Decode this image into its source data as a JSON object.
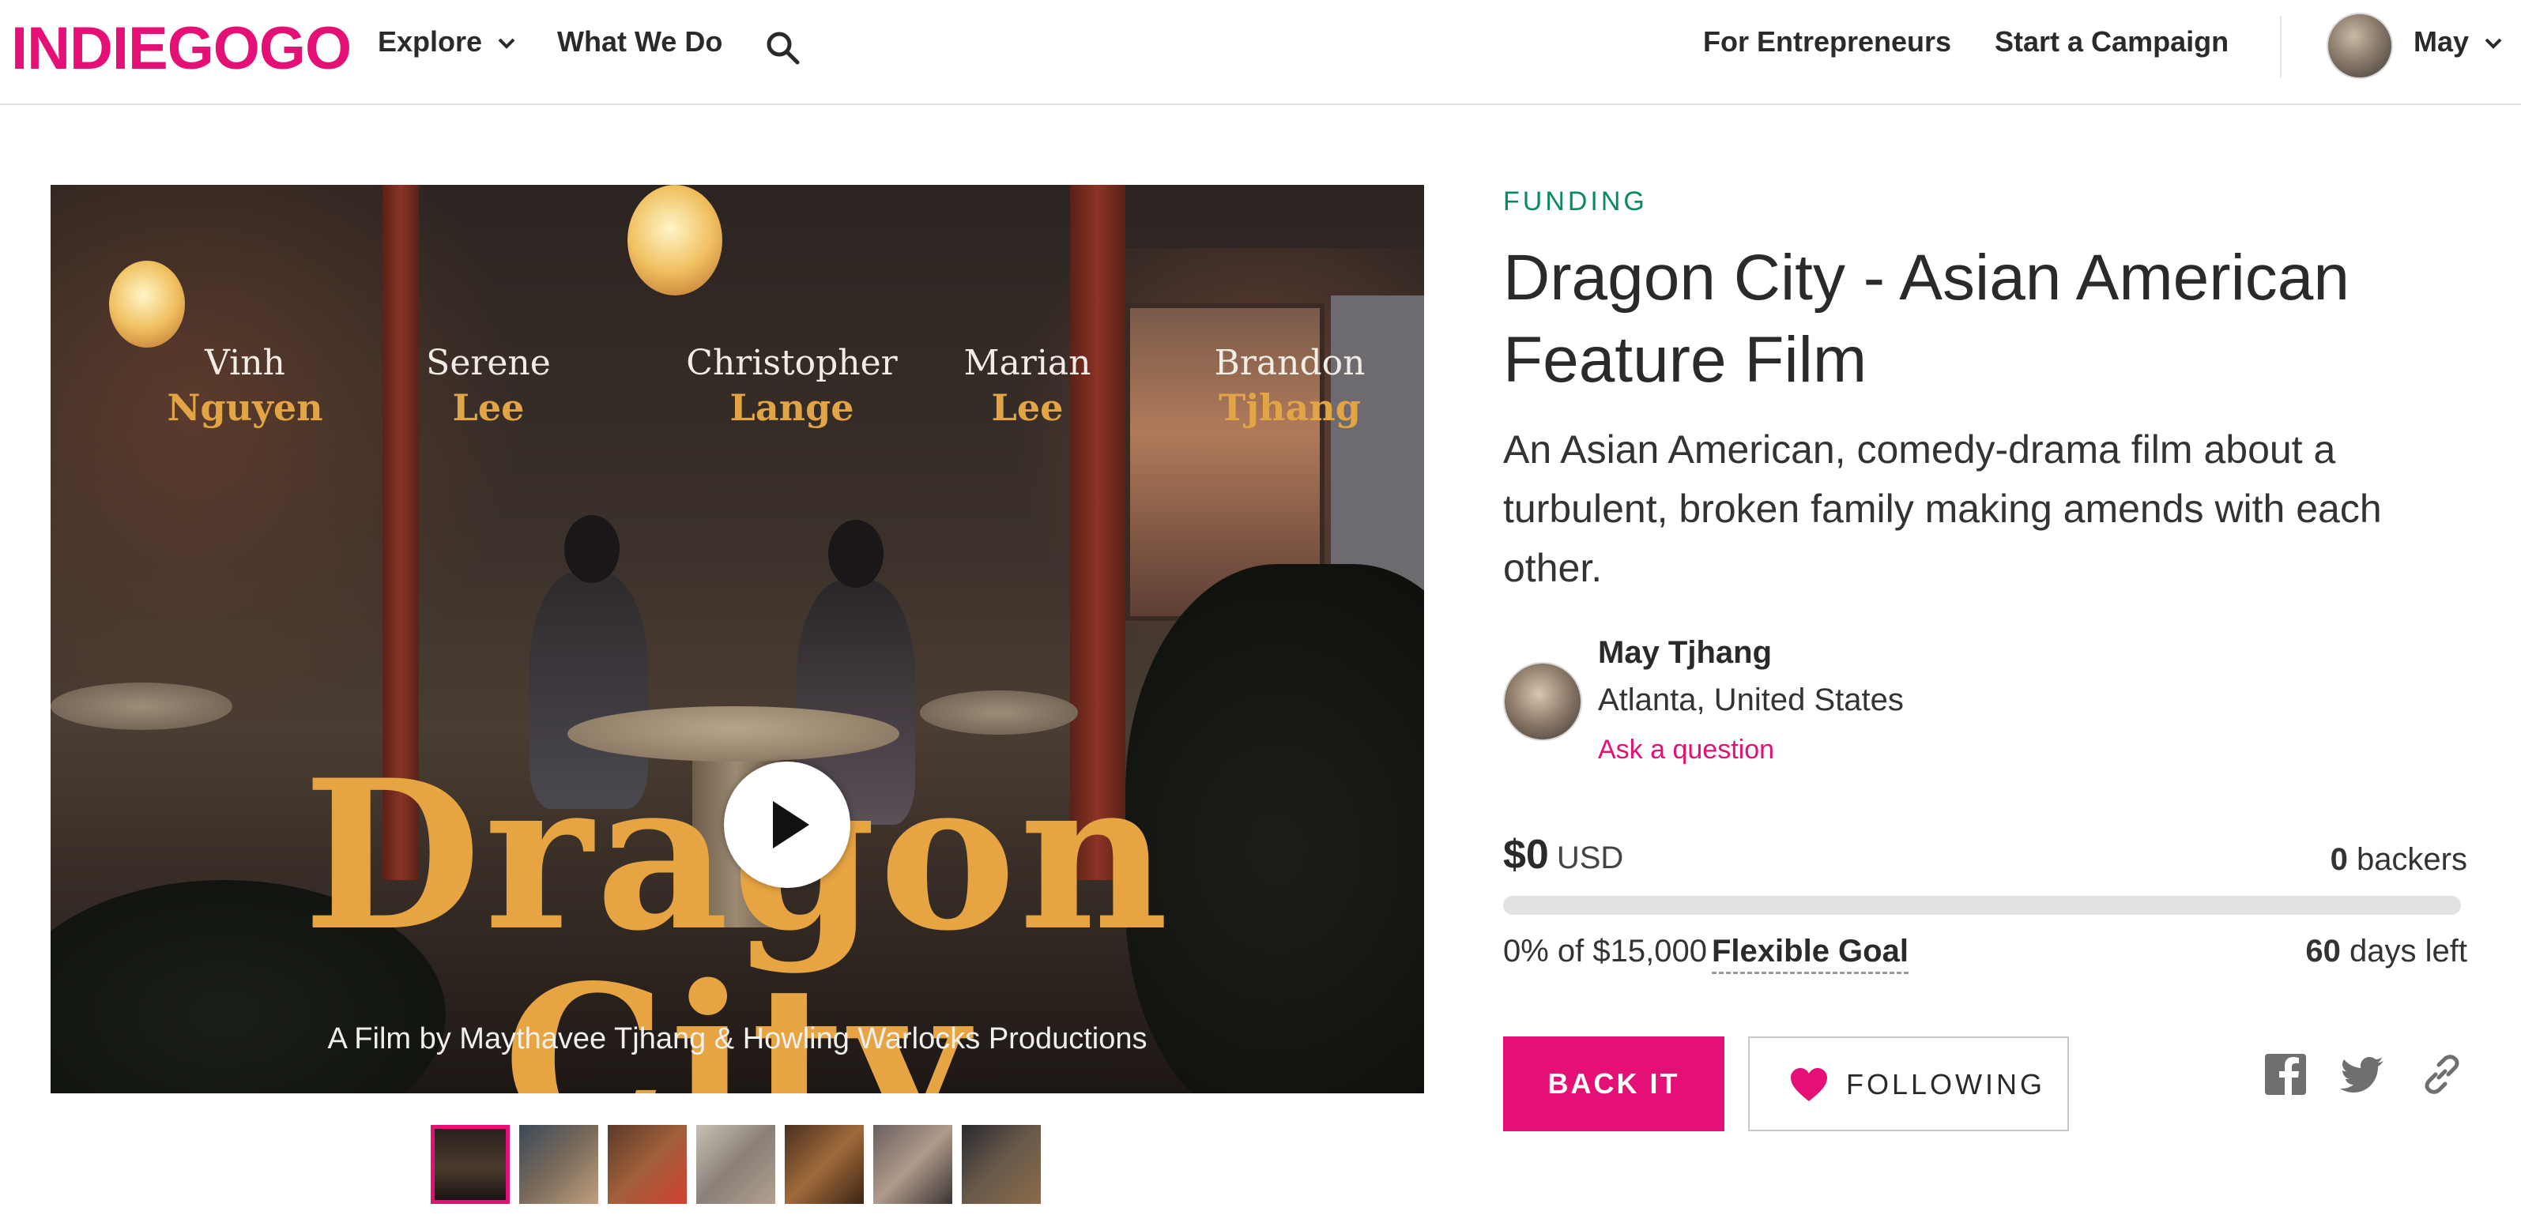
{
  "nav": {
    "logo": "INDIEGOGO",
    "explore": "Explore",
    "what_we_do": "What We Do",
    "for_entrepreneurs": "For Entrepreneurs",
    "start_campaign": "Start a Campaign",
    "user_name": "May",
    "icons": [
      "search-icon",
      "chevron-down-icon"
    ]
  },
  "media": {
    "cast": [
      {
        "first": "Vinh",
        "last": "Nguyen"
      },
      {
        "first": "Serene",
        "last": "Lee"
      },
      {
        "first": "Christopher",
        "last": "Lange"
      },
      {
        "first": "Marian",
        "last": "Lee"
      },
      {
        "first": "Brandon",
        "last": "Tjhang"
      }
    ],
    "film_title": "Dragon City",
    "credit": "A Film by Maythavee Tjhang & Howling Warlocks Productions",
    "thumbnail_count": 7,
    "active_thumbnail": 1
  },
  "campaign": {
    "status": "FUNDING",
    "title": "Dragon City - Asian American Feature Film",
    "tagline": "An Asian American, comedy-drama film about a turbulent, broken family making amends with each other.",
    "owner": {
      "name": "May Tjhang",
      "location": "Atlanta, United States",
      "ask": "Ask a question"
    },
    "amount": "$0",
    "currency": "USD",
    "backers_count": "0",
    "backers_label": " backers",
    "progress_percent": 0,
    "goal_text": "0% of $15,000",
    "goal_type": "Flexible Goal",
    "days_count": "60",
    "days_label": " days left",
    "back_button": "BACK IT",
    "follow_button": "FOLLOWING",
    "share_icons": [
      "facebook-icon",
      "twitter-icon",
      "link-icon"
    ]
  },
  "colors": {
    "brand": "#e51075",
    "status": "#0a8a64",
    "title_gold": "#e2a545"
  }
}
